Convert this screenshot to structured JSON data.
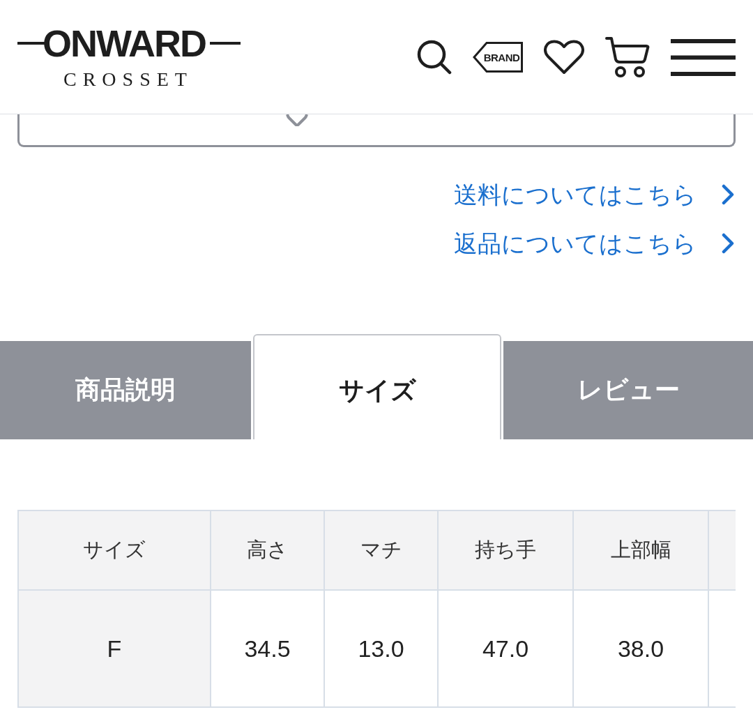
{
  "header": {
    "logo": {
      "wordmark": "ONWARD",
      "subline": "CROSSET"
    },
    "brand_label": "BRAND"
  },
  "links": [
    {
      "label": "送料についてはこちら"
    },
    {
      "label": "返品についてはこちら"
    }
  ],
  "tabs": [
    {
      "label": "商品説明",
      "selected": false
    },
    {
      "label": "サイズ",
      "selected": true
    },
    {
      "label": "レビュー",
      "selected": false
    }
  ],
  "size_table": {
    "columns": [
      "サイズ",
      "高さ",
      "マチ",
      "持ち手",
      "上部幅"
    ],
    "rows": [
      [
        "F",
        "34.5",
        "13.0",
        "47.0",
        "38.0"
      ]
    ]
  }
}
